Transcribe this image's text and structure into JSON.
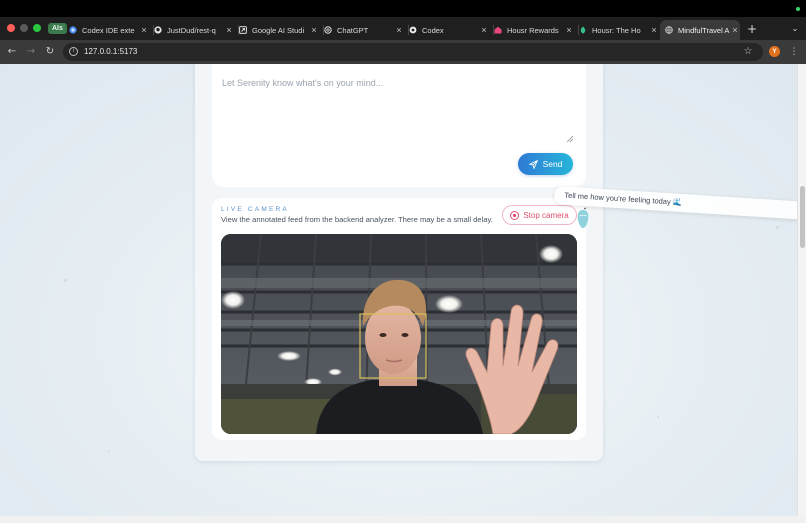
{
  "browser": {
    "tab_group": "AIs",
    "tabs": [
      {
        "title": "Codex IDE exte",
        "icon": "codex-extension-icon"
      },
      {
        "title": "JustDud/rest-q",
        "icon": "github-icon"
      },
      {
        "title": "Google AI Studi",
        "icon": "ai-studio-icon"
      },
      {
        "title": "ChatGPT",
        "icon": "openai-icon"
      },
      {
        "title": "Codex",
        "icon": "openai-icon"
      },
      {
        "title": "Housr Rewards",
        "icon": "housr-icon"
      },
      {
        "title": "Housr: The Ho",
        "icon": "housr-leaf-icon"
      },
      {
        "title": "MindfulTravel A",
        "icon": "globe-icon",
        "active": true
      }
    ],
    "new_tab": "+",
    "url": "127.0.0.1:5173",
    "profile_initial": "Y"
  },
  "chat": {
    "placeholder": "Let Serenity know what's on your mind...",
    "send_label": "Send"
  },
  "camera": {
    "eyebrow": "LIVE CAMERA",
    "description": "View the annotated feed from the backend analyzer. There may be a small delay.",
    "stop_label": "Stop camera",
    "face_box_color": "#d8c05a"
  },
  "floating_caption": "Tell me how you're feeling today 🌊",
  "colors": {
    "accent_start": "#2f7ad6",
    "accent_end": "#25b6d8",
    "stop": "#e0506f",
    "eyebrow": "#5b93c9"
  }
}
